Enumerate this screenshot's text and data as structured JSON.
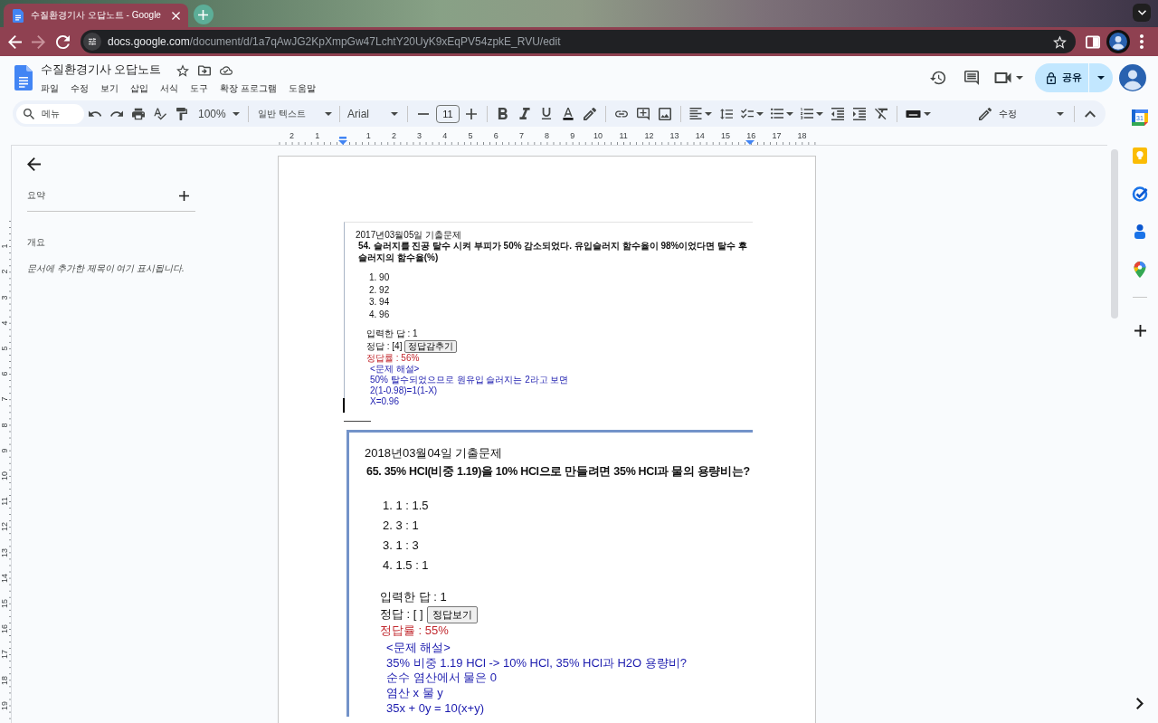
{
  "browser": {
    "tab_title": "수질환경기사 오답노트 - Google",
    "url_host": "docs.google.com",
    "url_path": "/document/d/1a7qAwJG2KpXmpGw47LchtY20UyK9xEqPV54zpkE_RVU/edit"
  },
  "docs_header": {
    "title": "수질환경기사 오답노트",
    "menu": [
      "파일",
      "수정",
      "보기",
      "삽입",
      "서식",
      "도구",
      "확장 프로그램",
      "도움말"
    ],
    "share_label": "공유"
  },
  "toolbar": {
    "search": {
      "placeholder": "메뉴"
    },
    "zoom": "100%",
    "paragraph_style": "일반 텍스트",
    "font": "Arial",
    "font_size": "11",
    "mode": "수정"
  },
  "rulers": {
    "horizontal": [
      "2",
      "1",
      "1",
      "2",
      "3",
      "4",
      "5",
      "6",
      "7",
      "8",
      "9",
      "10",
      "11",
      "12",
      "13",
      "14",
      "15",
      "16",
      "17",
      "18"
    ],
    "vertical": [
      "1",
      "2",
      "3",
      "4",
      "5",
      "6",
      "7",
      "8",
      "9",
      "10",
      "11",
      "12",
      "13",
      "14",
      "15",
      "16",
      "17",
      "18",
      "19"
    ]
  },
  "outline_panel": {
    "summary_heading": "요약",
    "outline_heading": "개요",
    "empty_note": "문서에 추가한 제목이 여기 표시됩니다."
  },
  "document": {
    "blocks": [
      {
        "kind": "compact",
        "date": "2017년03월05일 기출문제",
        "question": "54. 슬러지를 진공 탈수 시켜 부피가 50% 감소되었다. 유입슬러지 함수율이 98%이었다면 탈수 후 슬러지의 함수율(%)",
        "options": [
          "1. 90",
          "2. 92",
          "3. 94",
          "4. 96"
        ],
        "entered": "입력한 답 : 1",
        "answer": "정답 : [4]",
        "answer_button": "정답감추기",
        "rate": "정답률 : 56%",
        "explanation": [
          "<문제 해설>",
          "50% 탈수되었으므로 원유입 슬러지는 2라고 보면",
          "2(1-0.98)=1(1-X)",
          "X=0.96"
        ],
        "cursor": true
      },
      {
        "kind": "rule",
        "text": "———"
      },
      {
        "kind": "framed",
        "date": "2018년03월04일 기출문제",
        "question": "65. 35% HCl(비중 1.19)을 10% HCl으로 만들려면 35% HCl과 물의 용량비는?",
        "options": [
          "1. 1 : 1.5",
          "2. 3 : 1",
          "3. 1 : 3",
          "4. 1.5 : 1"
        ],
        "entered": "입력한 답 : 1",
        "answer": "정답 : [ ]",
        "answer_button": "정답보기",
        "rate": "정답률 : 55%",
        "explanation": [
          "<문제 해설>",
          "35% 비중 1.19 HCl -> 10% HCl, 35% HCl과 H2O 용량비?",
          "순수 염산에서 물은 0",
          "염산 x 물 y",
          "35x + 0y = 10(x+y)"
        ],
        "cursor": false
      }
    ]
  },
  "side_panel": {
    "calendar_day": "31"
  }
}
